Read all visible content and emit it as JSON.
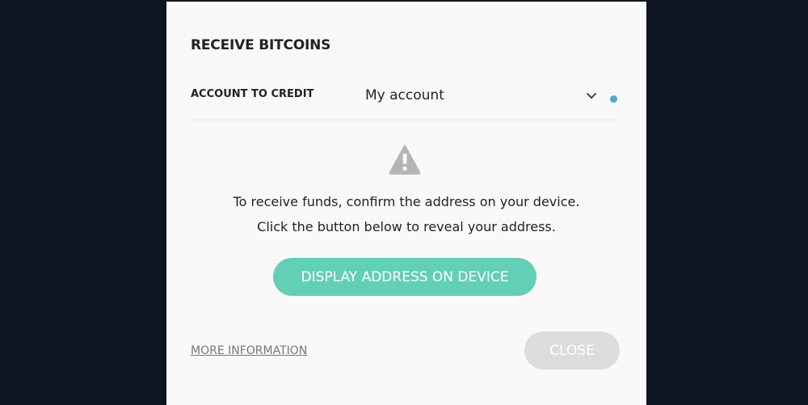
{
  "modal": {
    "title": "RECEIVE BITCOINS",
    "account": {
      "label": "ACCOUNT TO CREDIT",
      "selected": "My account",
      "status_color": "#4fa8d0"
    },
    "warning_icon": "warning-triangle-icon",
    "message_line1": "To receive funds, confirm the address on your device.",
    "message_line2": "Click the button below to reveal your address.",
    "display_button_label": "DISPLAY ADDRESS ON DEVICE",
    "more_info_label": "MORE INFORMATION",
    "close_button_label": "CLOSE"
  },
  "colors": {
    "accent": "#62cfb6",
    "disabled": "#dcdcdc",
    "backdrop": "#0e1420"
  }
}
